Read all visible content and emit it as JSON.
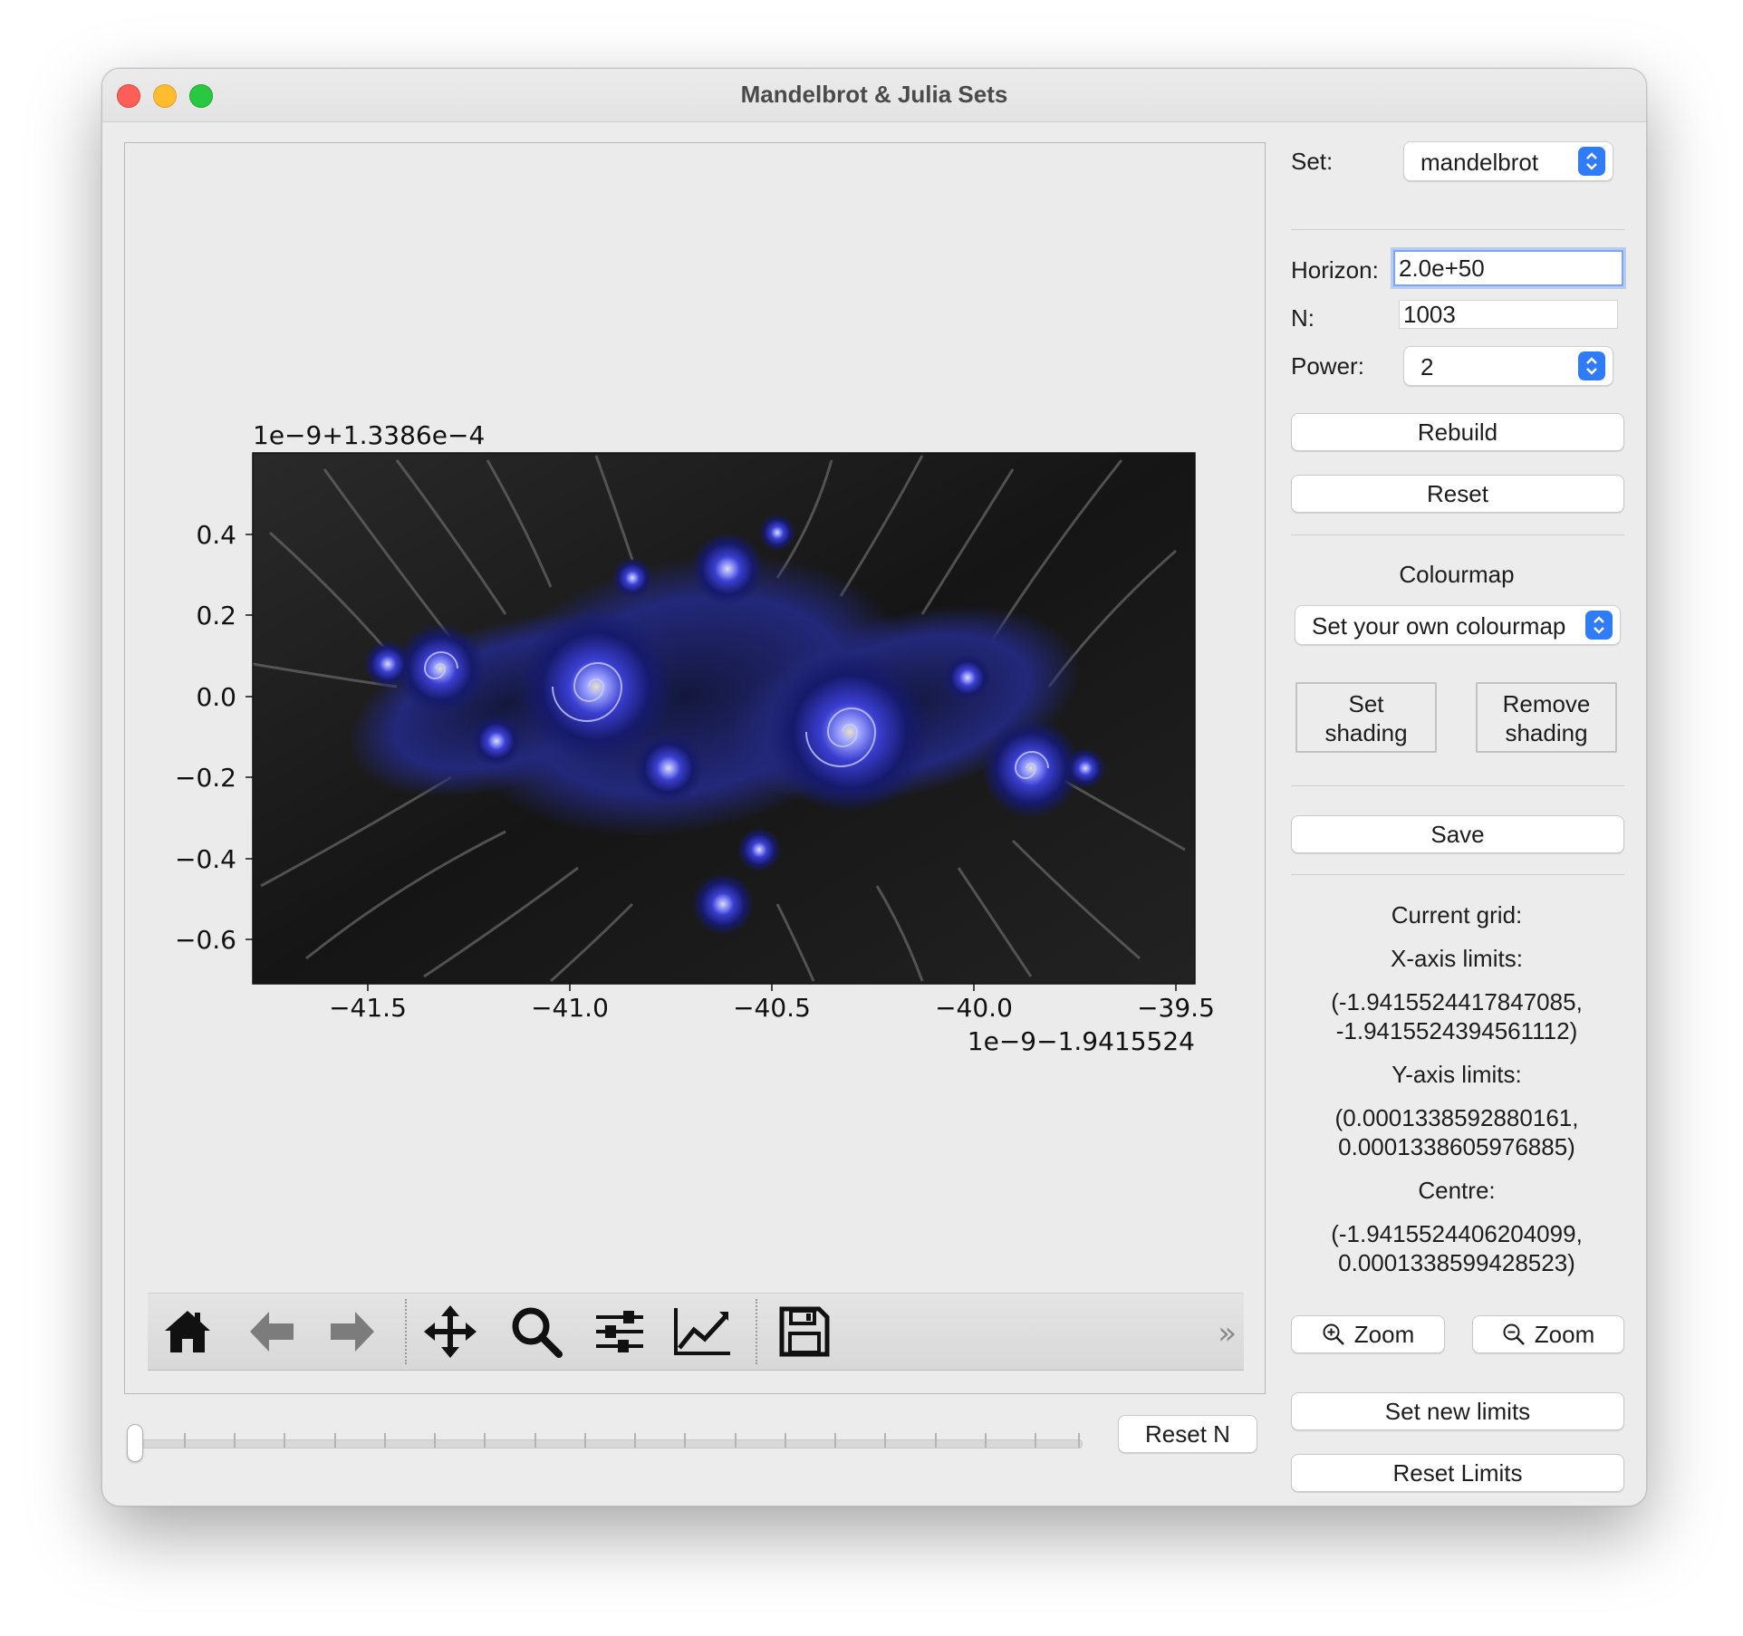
{
  "window": {
    "title": "Mandelbrot & Julia Sets"
  },
  "plot": {
    "x_offset_label": "1e−9−1.9415524",
    "y_offset_label": "1e−9+1.3386e−4",
    "x_ticks": [
      "−41.5",
      "−41.0",
      "−40.5",
      "−40.0",
      "−39.5"
    ],
    "y_ticks": [
      "0.4",
      "0.2",
      "0.0",
      "−0.2",
      "−0.4",
      "−0.6"
    ]
  },
  "toolbar": {
    "icons": [
      "home-icon",
      "back-arrow-icon",
      "forward-arrow-icon",
      "pan-move-icon",
      "zoom-magnifier-icon",
      "configure-subplots-icon",
      "edit-axes-curve-icon",
      "save-floppy-icon"
    ],
    "more": "»"
  },
  "slider": {
    "value": 0
  },
  "reset_n_label": "Reset N",
  "panel": {
    "set_label": "Set:",
    "set_value": "mandelbrot",
    "horizon_label": "Horizon:",
    "horizon_value": "2.0e+50",
    "n_label": "N:",
    "n_value": "1003",
    "power_label": "Power:",
    "power_value": "2",
    "rebuild": "Rebuild",
    "reset": "Reset",
    "colourmap_heading": "Colourmap",
    "colourmap_value": "Set your own colourmap",
    "set_shading_1": "Set",
    "set_shading_2": "shading",
    "remove_shading_1": "Remove",
    "remove_shading_2": "shading",
    "save": "Save",
    "current_grid": "Current grid:",
    "x_limits_label": "X-axis limits:",
    "x_limits_1": "(-1.9415524417847085,",
    "x_limits_2": "-1.9415524394561112)",
    "y_limits_label": "Y-axis limits:",
    "y_limits_1": "(0.0001338592880161,",
    "y_limits_2": "0.0001338605976885)",
    "centre_label": "Centre:",
    "centre_1": "(-1.9415524406204099,",
    "centre_2": "0.0001338599428523)",
    "zoom_in": "Zoom",
    "zoom_out": "Zoom",
    "set_new_limits": "Set new limits",
    "reset_limits": "Reset Limits"
  }
}
